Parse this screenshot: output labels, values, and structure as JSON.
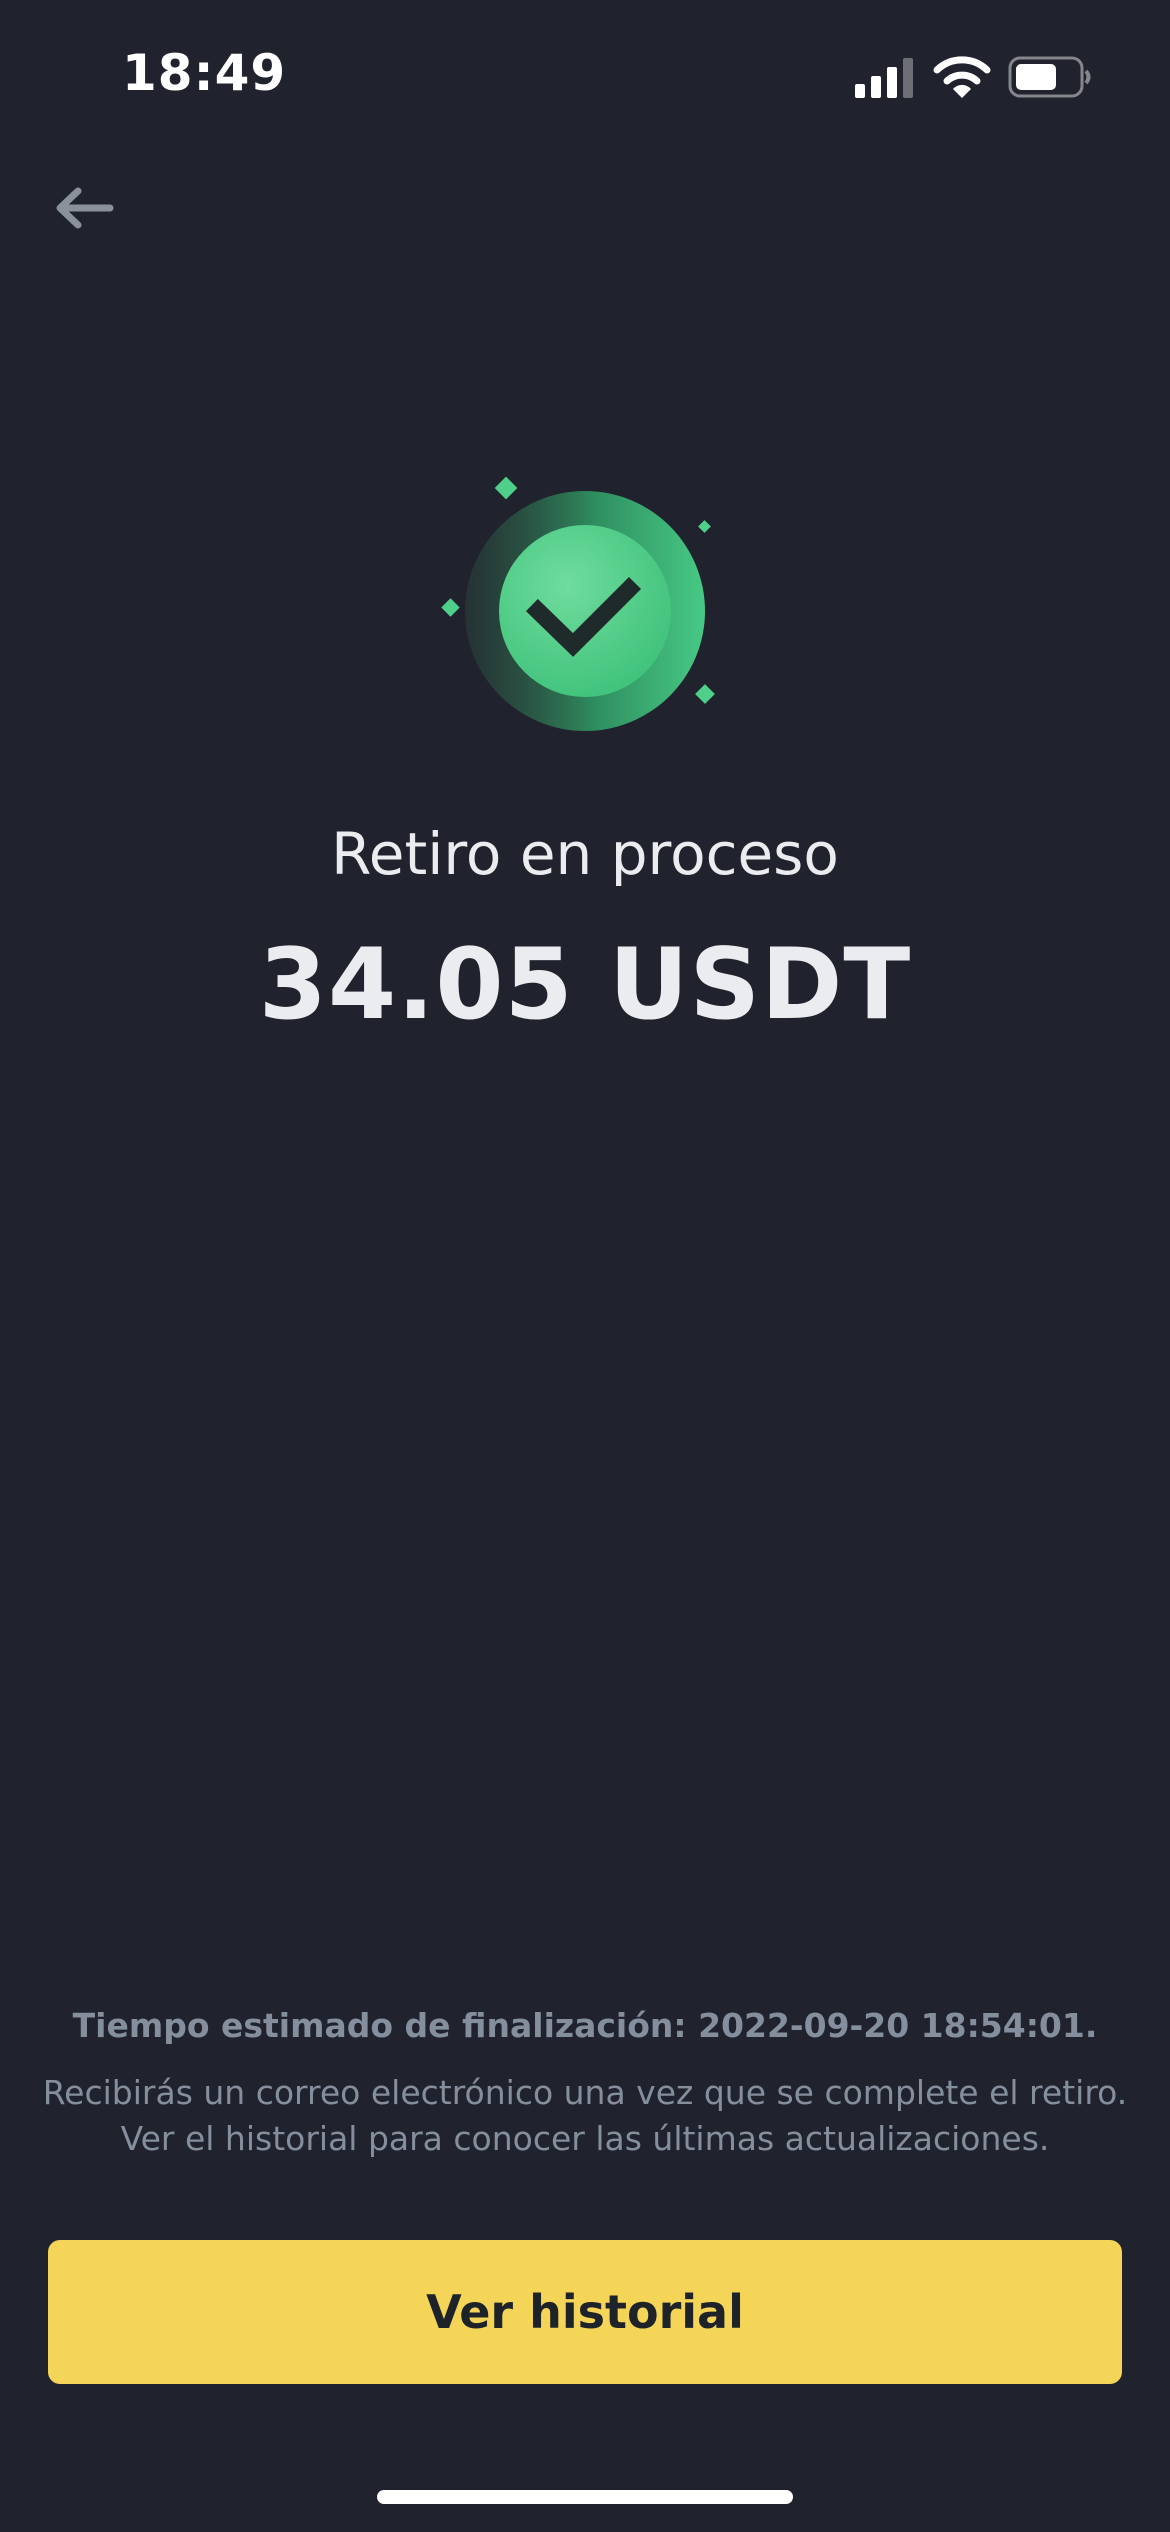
{
  "status_bar": {
    "time": "18:49",
    "signal_icon": "cellular-signal-icon",
    "wifi_icon": "wifi-icon",
    "battery_icon": "battery-icon",
    "battery_level": 0.6
  },
  "nav": {
    "back_icon": "arrow-left-icon"
  },
  "result": {
    "icon": "check-circle-icon",
    "title": "Retiro en proceso",
    "amount": "34.05 USDT"
  },
  "footer": {
    "eta": "Tiempo estimado de finalización: 2022-09-20 18:54:01.",
    "note_line1": "Recibirás un correo electrónico una vez que se complete el retiro.",
    "note_line2": "Ver el historial para conocer las últimas actualizaciones.",
    "button_label": "Ver historial"
  },
  "colors": {
    "background": "#20232e",
    "accent_green": "#3fc980",
    "button_yellow": "#f5d558",
    "text_primary": "#eaecef",
    "text_secondary": "#848e9c"
  }
}
